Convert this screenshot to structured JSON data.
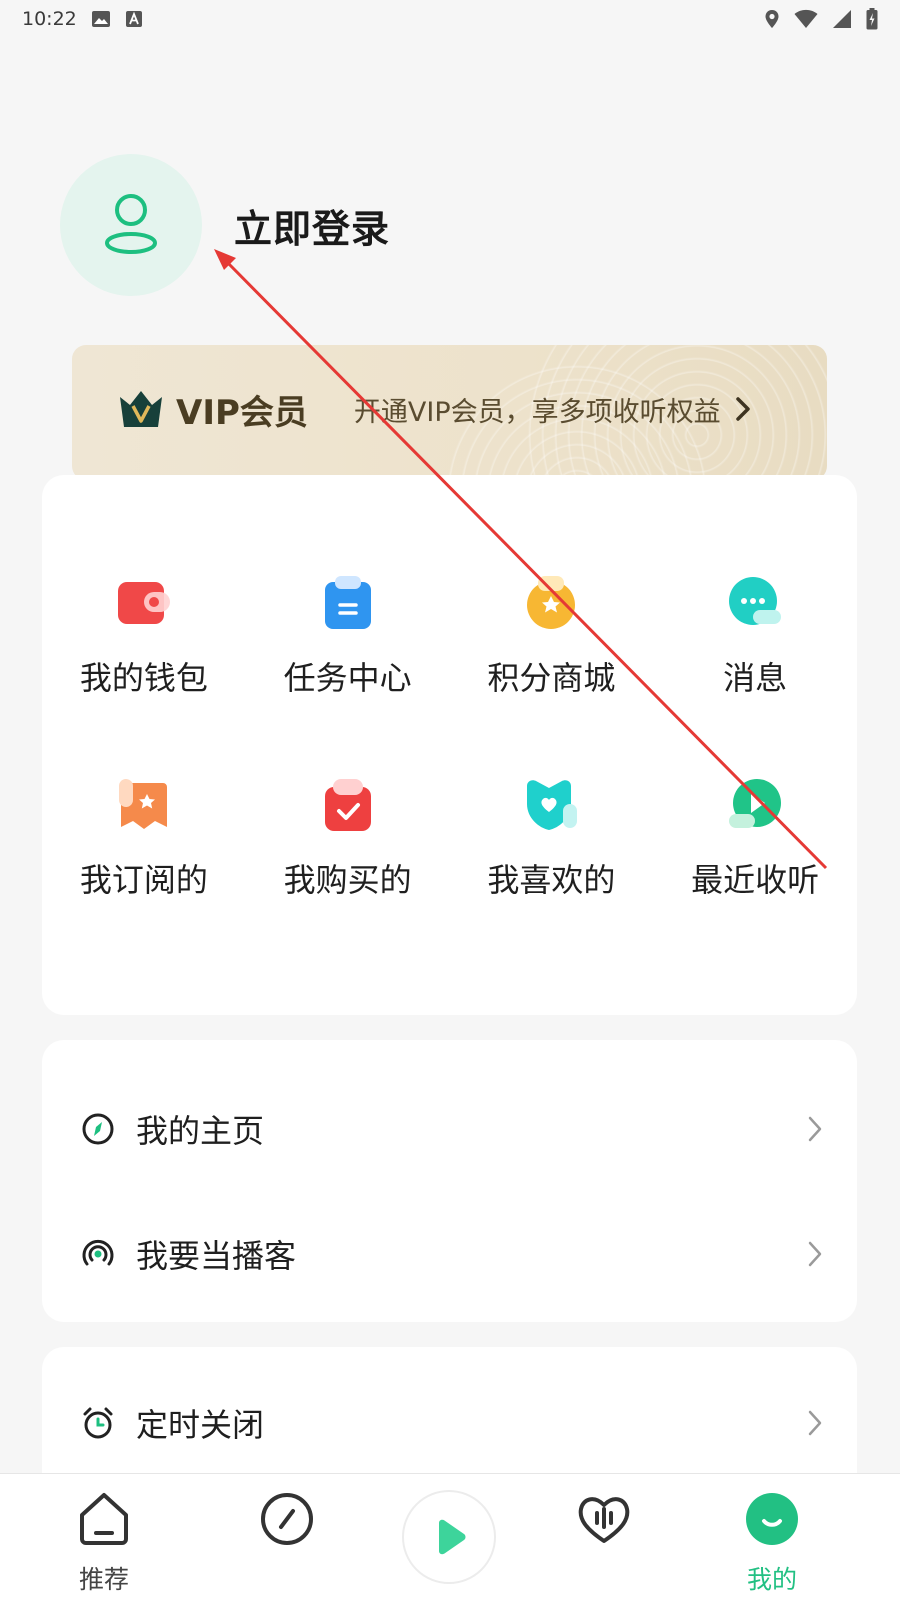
{
  "status_bar": {
    "time": "10:22"
  },
  "profile": {
    "login_label": "立即登录"
  },
  "vip": {
    "title": "VIP会员",
    "description": "开通VIP会员，享多项收听权益"
  },
  "grid": {
    "items": [
      {
        "label": "我的钱包",
        "icon": "wallet-icon",
        "color": "#f04848"
      },
      {
        "label": "任务中心",
        "icon": "task-clipboard-icon",
        "color": "#2f95f0"
      },
      {
        "label": "积分商城",
        "icon": "points-store-icon",
        "color": "#f7b733"
      },
      {
        "label": "消息",
        "icon": "message-icon",
        "color": "#21cfc4"
      },
      {
        "label": "我订阅的",
        "icon": "subscribe-icon",
        "color": "#f58a4b"
      },
      {
        "label": "我购买的",
        "icon": "purchase-bag-icon",
        "color": "#ee4040"
      },
      {
        "label": "我喜欢的",
        "icon": "heart-icon",
        "color": "#1fd0cc"
      },
      {
        "label": "最近收听",
        "icon": "play-history-icon",
        "color": "#20c488"
      }
    ]
  },
  "list_1": {
    "items": [
      {
        "label": "我的主页",
        "icon": "homepage-compass-icon"
      },
      {
        "label": "我要当播客",
        "icon": "podcast-broadcast-icon"
      }
    ]
  },
  "list_2": {
    "items": [
      {
        "label": "定时关闭",
        "icon": "alarm-clock-icon"
      }
    ]
  },
  "nav": {
    "items": [
      {
        "label": "推荐",
        "icon": "home-icon"
      },
      {
        "label": "",
        "icon": "compass-icon"
      },
      {
        "label": "",
        "icon": "play-icon"
      },
      {
        "label": "",
        "icon": "heart-wave-icon"
      },
      {
        "label": "我的",
        "icon": "profile-smile-icon"
      }
    ]
  },
  "colors": {
    "accent": "#22c083",
    "annotation": "#e53935",
    "vip_bg": "#ede2cb"
  }
}
